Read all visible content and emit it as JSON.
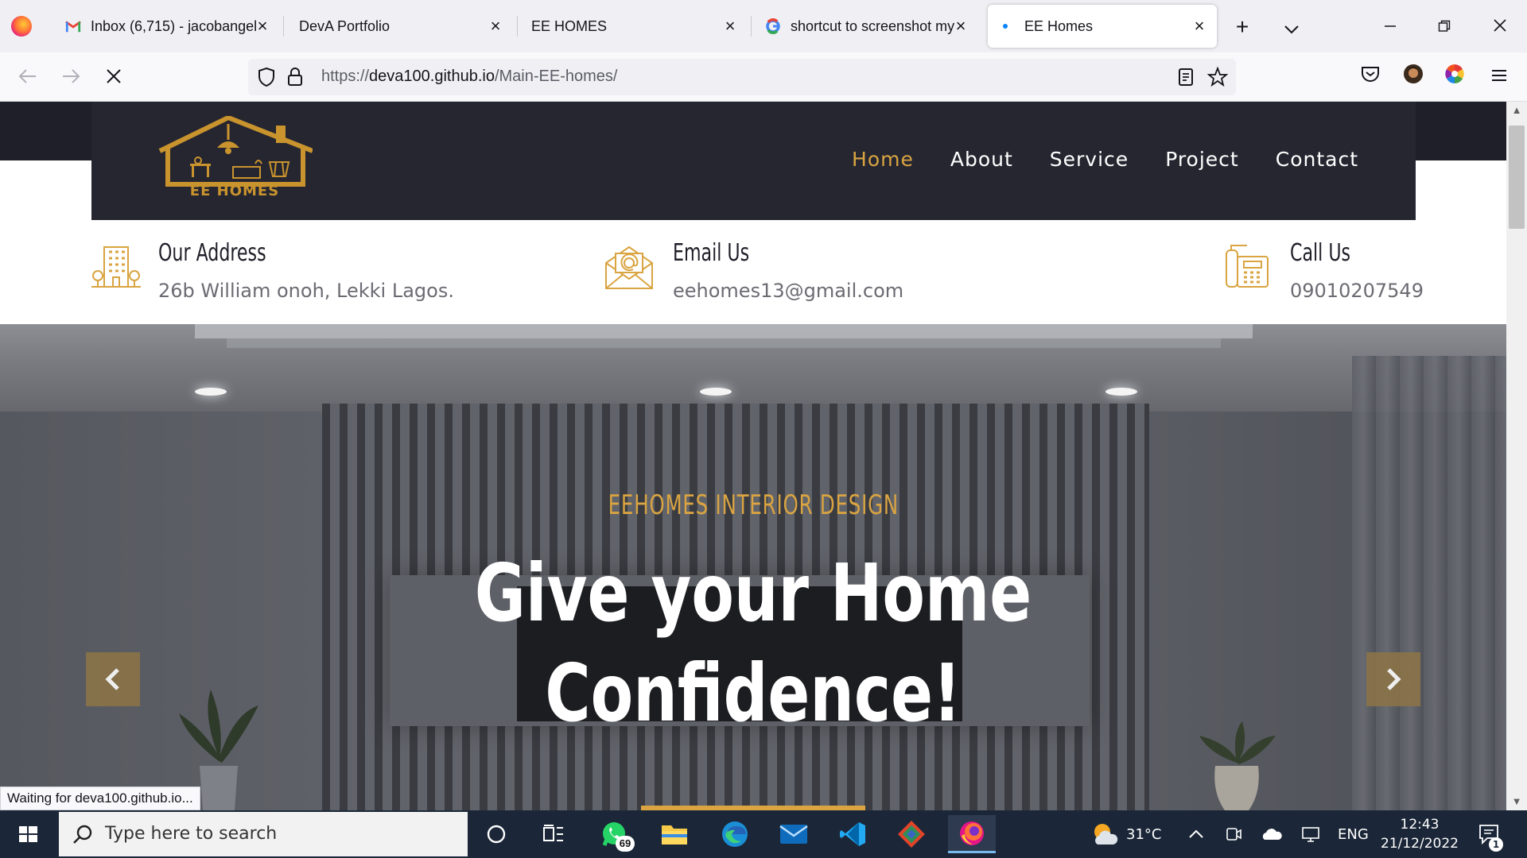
{
  "browser": {
    "tabs": [
      {
        "label": "Inbox (6,715) - jacobangel",
        "favicon": "gmail-icon"
      },
      {
        "label": "DevA Portfolio",
        "favicon": ""
      },
      {
        "label": "EE HOMES",
        "favicon": ""
      },
      {
        "label": "shortcut to screenshot my",
        "favicon": "google-icon"
      },
      {
        "label": "EE Homes",
        "favicon": "loading-dot-icon",
        "active": true
      }
    ],
    "url_prefix": "https://",
    "url_host": "deva100.github.io",
    "url_path": "/Main-EE-homes/",
    "status_text": "Waiting for deva100.github.io..."
  },
  "site": {
    "logo_text": "EE HOMES",
    "nav": [
      "Home",
      "About",
      "Service",
      "Project",
      "Contact"
    ],
    "active_nav": "Home",
    "info": [
      {
        "title": "Our Address",
        "value": "26b William onoh, Lekki Lagos.",
        "icon": "building-icon"
      },
      {
        "title": "Email Us",
        "value": "eehomes13@gmail.com",
        "icon": "envelope-icon"
      },
      {
        "title": "Call Us",
        "value": "09010207549",
        "icon": "phone-icon"
      }
    ],
    "hero": {
      "kicker": "EEHOMES INTERIOR DESIGN",
      "title_line1": "Give your Home",
      "title_line2": "Confidence!"
    }
  },
  "taskbar": {
    "search_placeholder": "Type here to search",
    "whatsapp_badge": "69",
    "weather": "31°C",
    "language": "ENG",
    "time": "12:43",
    "date": "21/12/2022",
    "notification_count": "1"
  },
  "colors": {
    "accent_gold": "#d9a441",
    "header_dark": "#262631",
    "taskbar": "#1b2738"
  }
}
